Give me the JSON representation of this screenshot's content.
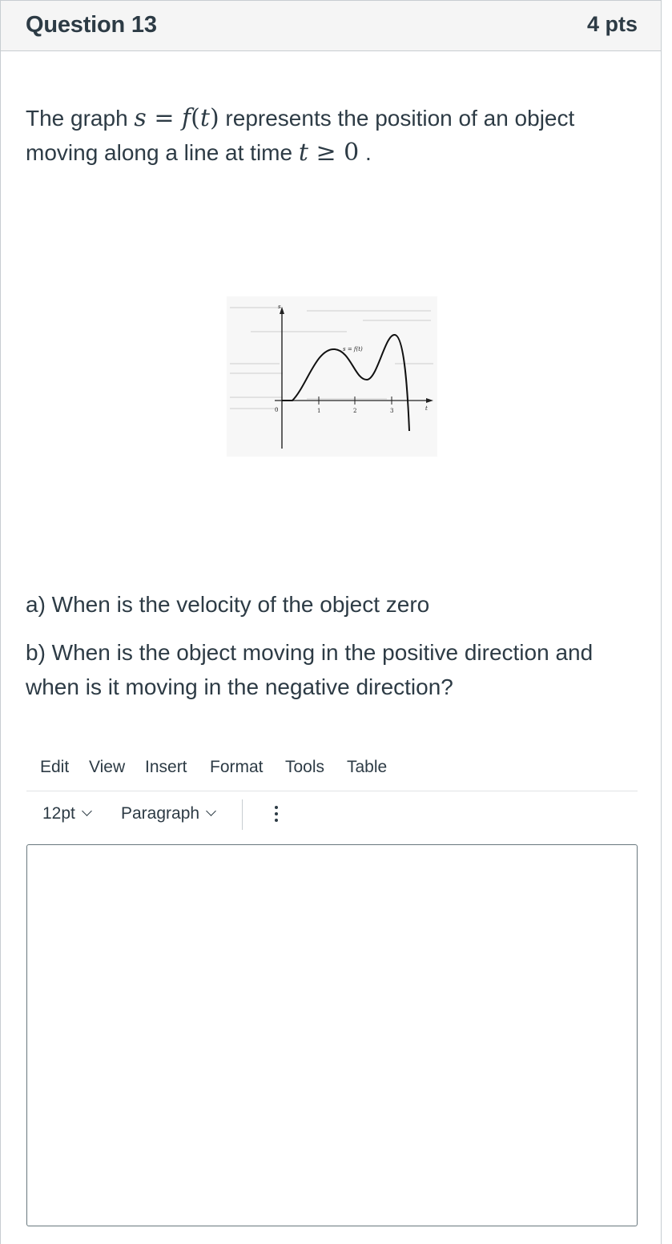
{
  "question": {
    "title": "Question 13",
    "points": "4 pts"
  },
  "prompt": {
    "text_before": "The graph ",
    "math_s": "s",
    "math_eq": " = ",
    "math_f": "f",
    "math_paren_open": "(",
    "math_t": "t",
    "math_paren_close": ")",
    "text_middle": " represents the position of an object moving along a line at time ",
    "math_t2": "t",
    "math_ge": " ≥ ",
    "math_zero": "0",
    "text_end": " ."
  },
  "graph": {
    "s_axis_label": "s",
    "t_axis_label": "t",
    "curve_label": "s = f(t)",
    "origin_label": "0",
    "tick_labels": [
      "1",
      "2",
      "3"
    ]
  },
  "questions": {
    "a": "a) When is the velocity of the object zero",
    "b": "b) When is the object moving in the positive direction and when is it moving in the negative direction?"
  },
  "editor": {
    "menu": [
      "Edit",
      "View",
      "Insert",
      "Format",
      "Tools",
      "Table"
    ],
    "font_size": "12pt",
    "block_format": "Paragraph",
    "content": ""
  }
}
